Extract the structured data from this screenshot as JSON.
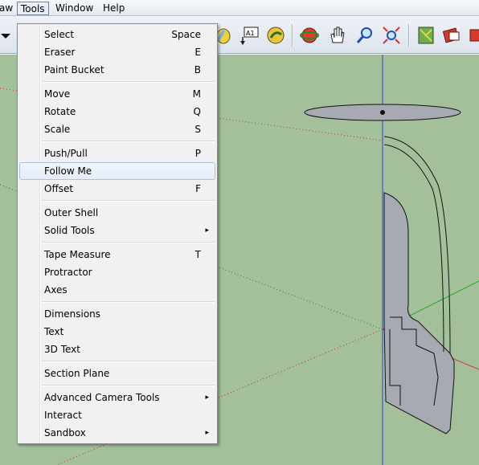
{
  "menubar": {
    "items": [
      {
        "label": "aw",
        "active": false
      },
      {
        "label": "Tools",
        "active": true
      },
      {
        "label": "Window",
        "active": false
      },
      {
        "label": "Help",
        "active": false
      }
    ]
  },
  "toolbar": {
    "tools": [
      "dropdown-arrow-icon",
      "paint-bucket-icon",
      "text-label-icon",
      "3d-text-icon",
      "orbit-icon",
      "pan-icon",
      "zoom-icon",
      "zoom-extents-icon",
      "map-icon",
      "model-info-icon",
      "component-icon"
    ]
  },
  "tools_menu": {
    "groups": [
      [
        {
          "label": "Select",
          "shortcut": "Space"
        },
        {
          "label": "Eraser",
          "shortcut": "E"
        },
        {
          "label": "Paint Bucket",
          "shortcut": "B"
        }
      ],
      [
        {
          "label": "Move",
          "shortcut": "M"
        },
        {
          "label": "Rotate",
          "shortcut": "Q"
        },
        {
          "label": "Scale",
          "shortcut": "S"
        }
      ],
      [
        {
          "label": "Push/Pull",
          "shortcut": "P"
        },
        {
          "label": "Follow Me",
          "shortcut": "",
          "highlighted": true
        },
        {
          "label": "Offset",
          "shortcut": "F"
        }
      ],
      [
        {
          "label": "Outer Shell",
          "shortcut": ""
        },
        {
          "label": "Solid Tools",
          "shortcut": "",
          "submenu": true
        }
      ],
      [
        {
          "label": "Tape Measure",
          "shortcut": "T"
        },
        {
          "label": "Protractor",
          "shortcut": ""
        },
        {
          "label": "Axes",
          "shortcut": ""
        }
      ],
      [
        {
          "label": "Dimensions",
          "shortcut": ""
        },
        {
          "label": "Text",
          "shortcut": ""
        },
        {
          "label": "3D Text",
          "shortcut": ""
        }
      ],
      [
        {
          "label": "Section Plane",
          "shortcut": ""
        }
      ],
      [
        {
          "label": "Advanced Camera Tools",
          "shortcut": "",
          "submenu": true
        },
        {
          "label": "Interact",
          "shortcut": ""
        },
        {
          "label": "Sandbox",
          "shortcut": "",
          "submenu": true
        }
      ]
    ],
    "submenu_arrow": "▸"
  },
  "colors": {
    "viewport": "#a3c09b",
    "axis_red": "#d83a2a",
    "axis_green": "#1fa51f",
    "axis_blue": "#2a3fd8",
    "model_fill": "#a7aab2",
    "highlight_border": "#a8c1e4"
  }
}
